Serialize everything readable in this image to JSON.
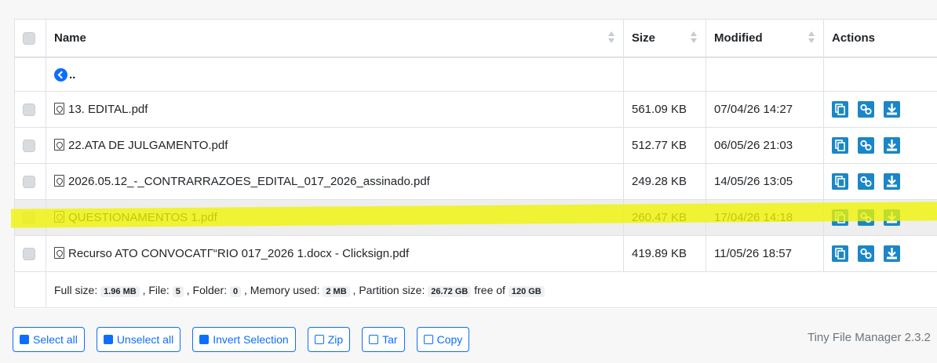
{
  "table": {
    "headers": {
      "name": "Name",
      "size": "Size",
      "modified": "Modified",
      "actions": "Actions"
    },
    "up_label": "..",
    "files": [
      {
        "name": "13. EDITAL.pdf",
        "size": "561.09 KB",
        "modified": "07/04/26 14:27",
        "highlighted": false
      },
      {
        "name": "22.ATA DE JULGAMENTO.pdf",
        "size": "512.77 KB",
        "modified": "06/05/26 21:03",
        "highlighted": false
      },
      {
        "name": "2026.05.12_-_CONTRARRAZOES_EDITAL_017_2026_assinado.pdf",
        "size": "249.28 KB",
        "modified": "14/05/26 13:05",
        "highlighted": false
      },
      {
        "name": "QUESTIONAMENTOS 1.pdf",
        "size": "260.47 KB",
        "modified": "17/04/26 14:18",
        "highlighted": true
      },
      {
        "name": "Recurso ATO CONVOCATГ“RIO 017_2026 1.docx - Clicksign.pdf",
        "size": "419.89 KB",
        "modified": "11/05/26 18:57",
        "highlighted": false
      }
    ],
    "row_actions": {
      "copy_icon": "copy-icon",
      "link_icon": "link-icon",
      "download_icon": "download-icon"
    }
  },
  "footer": {
    "full_size_label": "Full size:",
    "full_size": "1.96 MB",
    "file_label": ", File:",
    "files": "5",
    "folder_label": ", Folder:",
    "folders": "0",
    "memory_label": ", Memory used:",
    "memory": "2 MB",
    "partition_label": ", Partition size:",
    "partition": "26.72 GB",
    "free_label": "free of",
    "total": "120 GB"
  },
  "buttons": {
    "select_all": "Select all",
    "unselect_all": "Unselect all",
    "invert": "Invert Selection",
    "zip": "Zip",
    "tar": "Tar",
    "copy": "Copy"
  },
  "version": "Tiny File Manager 2.3.2",
  "colors": {
    "accent": "#0d6efd",
    "action_icon": "#1b86c7",
    "highlight": "#f0f500"
  }
}
